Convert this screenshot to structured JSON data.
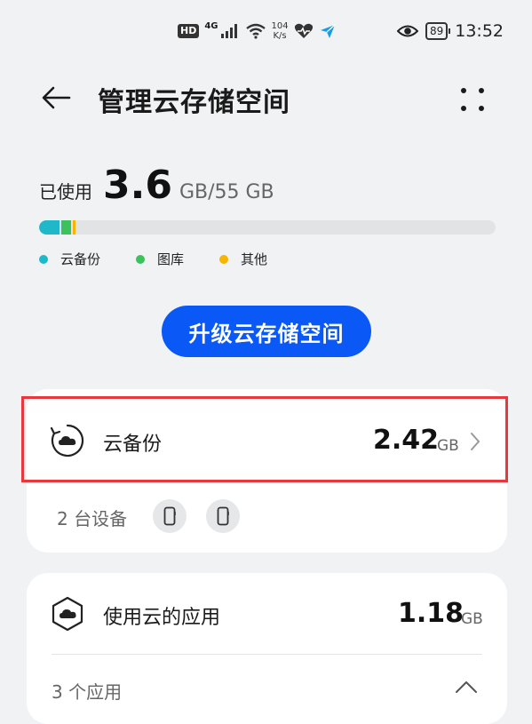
{
  "status_bar": {
    "hd": "HD",
    "network": "4G",
    "speed_value": "104",
    "speed_unit": "K/s",
    "battery": "89",
    "time": "13:52"
  },
  "header": {
    "title": "管理云存储空间"
  },
  "storage": {
    "used_label": "已使用",
    "used_value": "3.6",
    "total": "GB/55 GB",
    "segments": [
      {
        "name": "云备份",
        "fraction": 0.044,
        "color": "#1fb8c9"
      },
      {
        "name": "图库",
        "fraction": 0.021,
        "color": "#3cc25c"
      },
      {
        "name": "其他",
        "fraction": 0.004,
        "color": "#f7b500"
      }
    ]
  },
  "legend": [
    {
      "label": "云备份",
      "color": "#1fb8c9"
    },
    {
      "label": "图库",
      "color": "#3cc25c"
    },
    {
      "label": "其他",
      "color": "#f7b500"
    }
  ],
  "upgrade_label": "升级云存储空间",
  "backup": {
    "title": "云备份",
    "value": "2.42",
    "unit": "GB",
    "devices_text": "2 台设备"
  },
  "apps": {
    "title": "使用云的应用",
    "value": "1.18",
    "unit": "GB",
    "count_text": "3 个应用"
  }
}
